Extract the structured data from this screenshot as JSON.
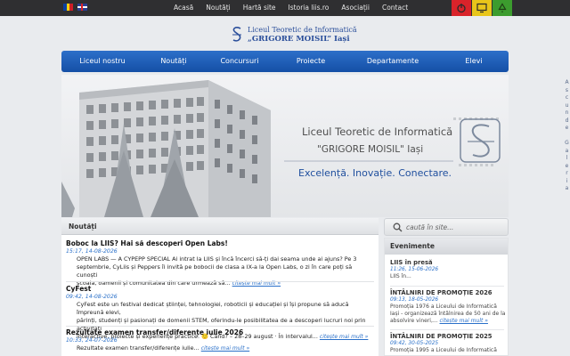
{
  "topbar": {
    "links": [
      "Acasă",
      "Noutăți",
      "Hartă site",
      "Istoria liis.ro",
      "Asociații",
      "Contact"
    ]
  },
  "header": {
    "logo_line1": "Liceul Teoretic de Informatică",
    "logo_line2": "„GRIGORE MOISIL” Iași"
  },
  "nav": {
    "items": [
      "Liceul nostru",
      "Noutăți",
      "Concursuri",
      "Proiecte",
      "Departamente",
      "Elevi"
    ]
  },
  "hero": {
    "title": "Liceul Teoretic de Informatică",
    "subtitle": "\"GRIGORE MOISIL\" Iași",
    "slogan": "Excelență. Inovație. Conectare."
  },
  "news": {
    "heading": "Noutăți",
    "more_label": "citește mai mult »",
    "items": [
      {
        "title": "Boboc la LIIS? Hai să descoperi Open Labs!",
        "date": "15:17, 14-08-2026",
        "body_lines": [
          "OPEN LABS — A CYPEPP SPECIAL Ai intrat la LIIS și încă încerci să-ți dai seama unde ai ajuns? Pe 3",
          "septembrie, CyLiis și Peppers îi invită pe bobocii de clasa a IX-a la Open Labs, o zi în care poți să cunoști",
          "școala, oamenii și comunitatea din care urmează să..."
        ]
      },
      {
        "title": "CyFest",
        "date": "09:42, 14-08-2026",
        "body_lines": [
          "CyFest este un festival dedicat științei, tehnologiei, roboticii și educației și își propune să aducă împreună elevi,",
          "părinți, studenți și pasionați de domenii STEM, oferindu-le posibilitatea de a descoperi lucruri noi prin activități",
          "interactive, proiecte și experiențe practice. 🙂 Când? – 28–29 august · În intervalul..."
        ]
      },
      {
        "title": "Rezultate examen transfer/diferențe iulie 2026",
        "date": "10:33, 24-07-2026",
        "body_lines": [
          "Rezultate examen transfer/diferențe iulie..."
        ]
      }
    ]
  },
  "search": {
    "placeholder": "caută în site..."
  },
  "events": {
    "heading": "Evenimente",
    "items": [
      {
        "title": "LIIS în presă",
        "date": "11:26, 15-06-2026",
        "body": "LIIS în..."
      },
      {
        "title": "ÎNTÂLNIRI DE PROMOȚIE 2026",
        "date": "09:13, 18-05-2026",
        "body": "Promoția 1976 a Liceului de Informatică Iași - organizează întâlnirea de 50 ani de la absolvire vineri,..."
      },
      {
        "title": "ÎNTÂLNIRI DE PROMOȚIE 2025",
        "date": "09:42, 30-05-2025",
        "body": "Promoția 1995 a Liceului de Informatică"
      }
    ]
  },
  "side_strip": {
    "letters": [
      "A",
      "s",
      "c",
      "u",
      "n",
      "d",
      "e",
      "",
      "G",
      "a",
      "l",
      "e",
      "r",
      "i",
      "a"
    ]
  },
  "colors": {
    "nav_blue": "#1a5bb3",
    "link_blue": "#2a70c9",
    "accent_red": "#d9232a",
    "accent_yellow": "#e8c51a",
    "accent_green": "#3c9c2e"
  },
  "icons": {
    "red_button": "power-icon",
    "yellow_button": "display-icon",
    "green_button": "recycle-icon",
    "search": "search-icon"
  }
}
